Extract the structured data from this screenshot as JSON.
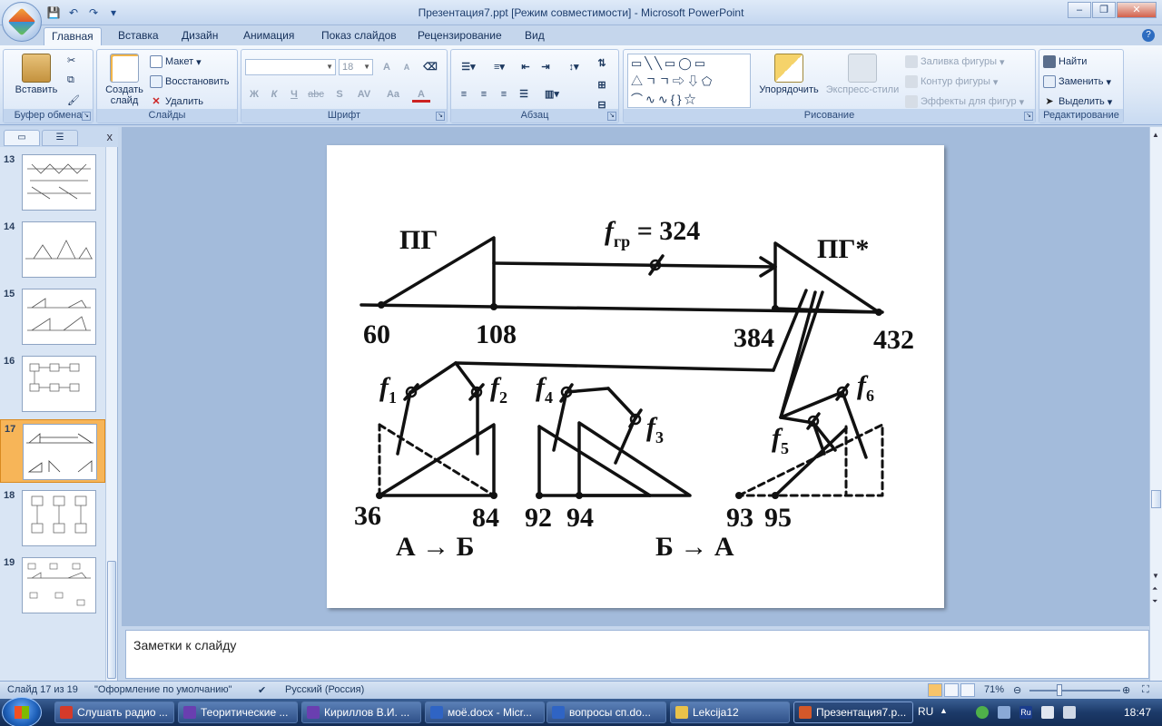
{
  "window": {
    "title": "Презентация7.ppt [Режим совместимости] - Microsoft PowerPoint",
    "controls": [
      "–",
      "❐",
      "✕"
    ]
  },
  "quick_access": [
    "💾",
    "↶",
    "↷",
    "▾"
  ],
  "tabs": [
    "Главная",
    "Вставка",
    "Дизайн",
    "Анимация",
    "Показ слайдов",
    "Рецензирование",
    "Вид"
  ],
  "ribbon": {
    "clipboard": {
      "label": "Буфер обмена",
      "paste": "Вставить"
    },
    "slides": {
      "label": "Слайды",
      "create": "Создать слайд",
      "layout": "Макет",
      "reset": "Восстановить",
      "delete": "Удалить"
    },
    "font": {
      "label": "Шрифт",
      "font_name": "",
      "font_size": "18",
      "bold": "Ж",
      "italic": "К",
      "underline": "Ч",
      "strike": "abc",
      "shadow": "S",
      "spacing": "AV",
      "case": "Aa",
      "color": "A",
      "grow": "A",
      "shrink": "A"
    },
    "paragraph": {
      "label": "Абзац"
    },
    "drawing": {
      "label": "Рисование",
      "arrange": "Упорядочить",
      "quick_styles": "Экспресс-стили",
      "fill": "Заливка фигуры",
      "outline": "Контур фигуры",
      "effects": "Эффекты для фигур"
    },
    "editing": {
      "label": "Редактирование",
      "find": "Найти",
      "replace": "Заменить",
      "select": "Выделить"
    }
  },
  "slides_pane": {
    "close": "x",
    "items": [
      {
        "num": "13",
        "selected": false
      },
      {
        "num": "14",
        "selected": false
      },
      {
        "num": "15",
        "selected": false
      },
      {
        "num": "16",
        "selected": false
      },
      {
        "num": "17",
        "selected": true
      },
      {
        "num": "18",
        "selected": false
      },
      {
        "num": "19",
        "selected": false
      }
    ]
  },
  "slide": {
    "labels": {
      "pg": "ПГ",
      "pg_star": "ПГ*",
      "fgr_f": "f",
      "fgr_sub": "гр",
      "fgr_val": "= 324",
      "n60": "60",
      "n108": "108",
      "n384": "384",
      "n432": "432",
      "f1": "1",
      "f2": "2",
      "f3": "3",
      "f4": "4",
      "f5": "5",
      "f6": "6",
      "f": "f",
      "n36": "36",
      "n84": "84",
      "n92": "92",
      "n94": "94",
      "n93": "93",
      "n95": "95",
      "a_to_b": "А → Б",
      "b_to_a": "Б → А"
    }
  },
  "notes": {
    "text": "Заметки к слайду"
  },
  "status": {
    "slide_info": "Слайд 17 из 19",
    "theme": "\"Оформление по умолчанию\"",
    "language": "Русский (Россия)",
    "zoom": "71%"
  },
  "taskbar": {
    "items": [
      {
        "label": "Слушать радио ...",
        "color": "#d43a2a"
      },
      {
        "label": "Теоритические ...",
        "color": "#6a3fb0"
      },
      {
        "label": "Кириллов В.И. ...",
        "color": "#6a3fb0"
      },
      {
        "label": "моё.docx - Micr...",
        "color": "#2f64c4"
      },
      {
        "label": "вопросы сп.do...",
        "color": "#2f64c4"
      },
      {
        "label": "Lekcija12",
        "color": "#e9c24a"
      },
      {
        "label": "Презентация7.р...",
        "color": "#d3582a"
      }
    ],
    "lang": "RU",
    "time": "18:47"
  }
}
